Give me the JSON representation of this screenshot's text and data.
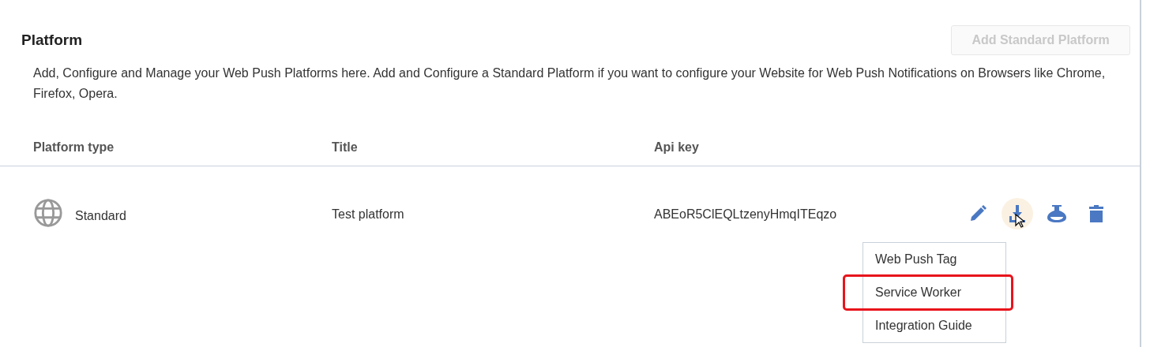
{
  "section": {
    "title": "Platform",
    "add_button": {
      "label": "Add Standard Platform",
      "disabled": true
    },
    "description": "Add, Configure and Manage your Web Push Platforms here. Add and Configure a Standard Platform if you want to configure your Website for Web Push Notifications on Browsers like Chrome, Firefox, Opera."
  },
  "table": {
    "columns": [
      "Platform type",
      "Title",
      "Api key"
    ],
    "rows": [
      {
        "platform_type": "Standard",
        "title": "Test platform",
        "api_key": "ABEoR5ClEQLtzenyHmqITEqzo",
        "actions": [
          {
            "kind": "edit",
            "active": false
          },
          {
            "kind": "download",
            "active": true
          },
          {
            "kind": "test",
            "active": false
          },
          {
            "kind": "delete",
            "active": false
          }
        ],
        "menu": [
          {
            "label": "Web Push Tag",
            "highlighted": false
          },
          {
            "label": "Service Worker",
            "highlighted": true
          },
          {
            "label": "Integration Guide",
            "highlighted": false
          }
        ]
      }
    ]
  }
}
